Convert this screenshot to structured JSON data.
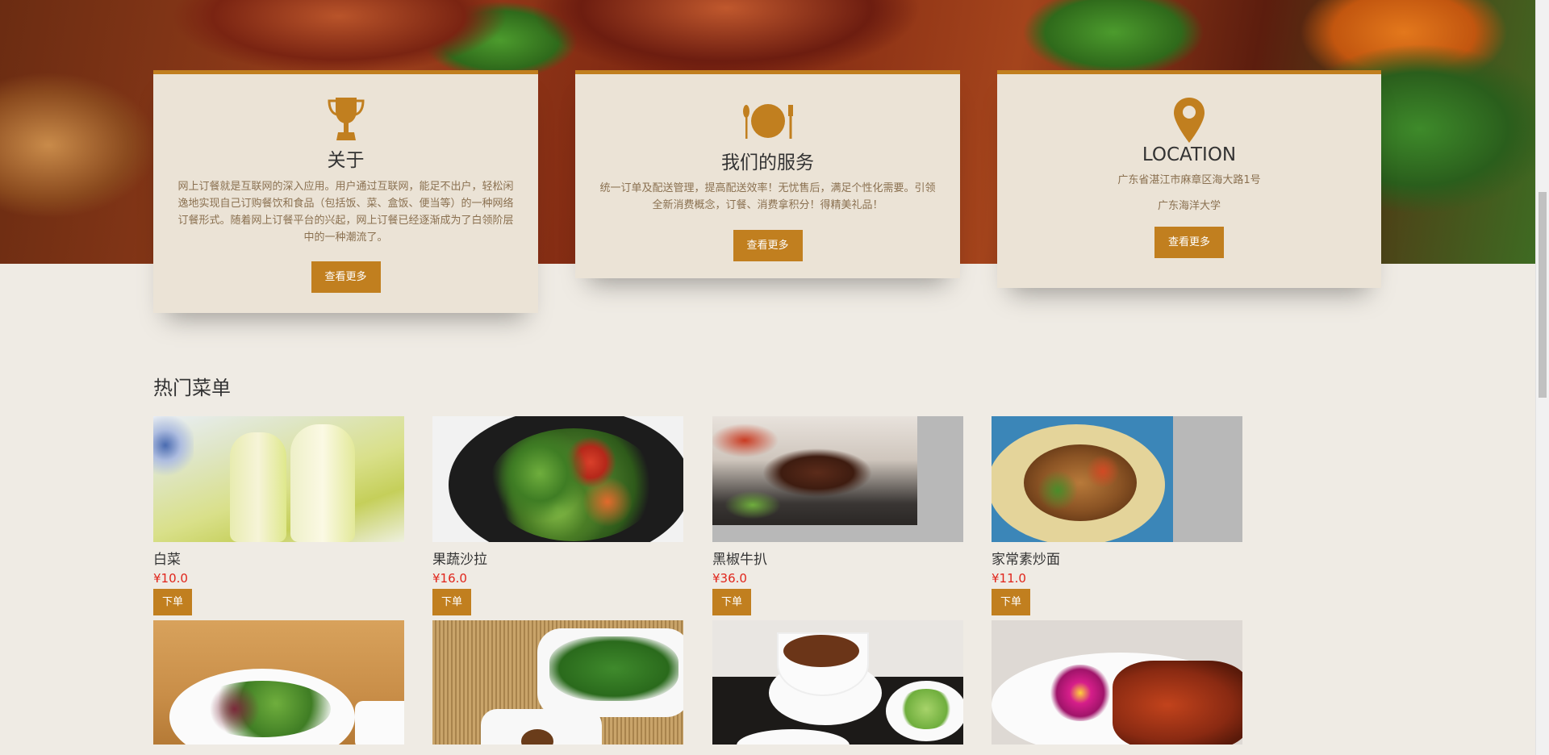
{
  "cards": [
    {
      "icon": "trophy-icon",
      "title": "关于",
      "lines": [
        "网上订餐就是互联网的深入应用。用户通过互联网，能足不出户，轻松闲逸地实现自己订购餐饮和食品（包括饭、菜、盒饭、便当等）的一种网络订餐形式。随着网上订餐平台的兴起，网上订餐已经逐渐成为了白领阶层中的一种潮流了。"
      ],
      "button": "查看更多"
    },
    {
      "icon": "plate-cutlery-icon",
      "title": "我们的服务",
      "lines": [
        "统一订单及配送管理，提高配送效率！无忧售后，满足个性化需要。引领全新消费概念，订餐、消费拿积分！得精美礼品！"
      ],
      "button": "查看更多"
    },
    {
      "icon": "location-pin-icon",
      "title": "LOCATION",
      "lines": [
        "广东省湛江市麻章区海大路1号",
        "广东海洋大学"
      ],
      "button": "查看更多"
    }
  ],
  "section": {
    "title": "热门菜单"
  },
  "menu": [
    {
      "name": "白菜",
      "price": "¥10.0",
      "button": "下单"
    },
    {
      "name": "果蔬沙拉",
      "price": "¥16.0",
      "button": "下单"
    },
    {
      "name": "黑椒牛扒",
      "price": "¥36.0",
      "button": "下单"
    },
    {
      "name": "家常素炒面",
      "price": "¥11.0",
      "button": "下单"
    }
  ],
  "colors": {
    "accent": "#c17f1f",
    "price": "#e0251b",
    "card_bg": "#ebe3d6",
    "page_bg": "#efebe4"
  }
}
